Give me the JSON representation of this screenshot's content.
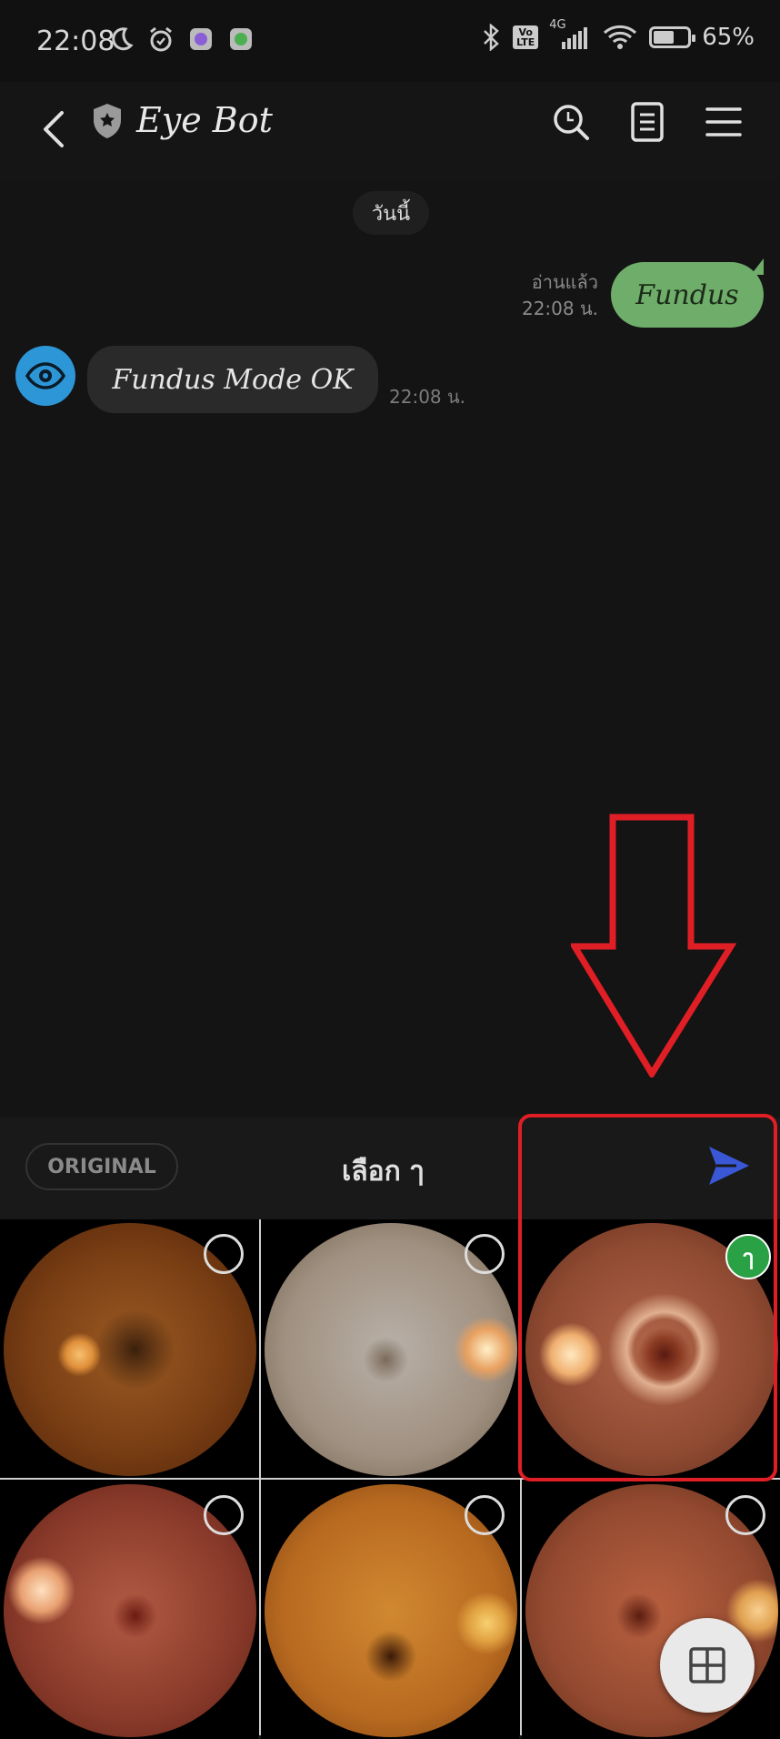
{
  "status_bar": {
    "time": "22:08",
    "network": "4G",
    "volte": "Vo LTE",
    "battery_percent": "65%",
    "battery_level": 0.65
  },
  "header": {
    "title": "Eye Bot",
    "icons": [
      "back-arrow-icon",
      "shield-star-icon",
      "search-icon",
      "notes-icon",
      "menu-icon"
    ]
  },
  "chat": {
    "date_label": "วันนี้",
    "messages": [
      {
        "sender": "me",
        "text": "Fundus",
        "read_label": "อ่านแล้ว",
        "time": "22:08 น.",
        "color": "#6fae6a"
      },
      {
        "sender": "bot",
        "text": "Fundus Mode OK",
        "time": "22:08 น.",
        "avatar_icon": "eye-icon",
        "avatar_color": "#2d96d6"
      }
    ]
  },
  "selection_bar": {
    "original_label": "ORIGINAL",
    "selected_label": "เลือก ๅ",
    "send_icon": "send-icon",
    "send_color": "#3a57d6"
  },
  "photos": [
    {
      "selected": false,
      "tint": "dark-orange"
    },
    {
      "selected": false,
      "tint": "pale"
    },
    {
      "selected": true,
      "badge": "ๅ",
      "tint": "red-lesion"
    },
    {
      "selected": false,
      "tint": "red"
    },
    {
      "selected": false,
      "tint": "orange"
    },
    {
      "selected": false,
      "tint": "red-brown"
    }
  ],
  "annotation": {
    "color": "#e01e25"
  },
  "fab_icon": "grid-icon"
}
